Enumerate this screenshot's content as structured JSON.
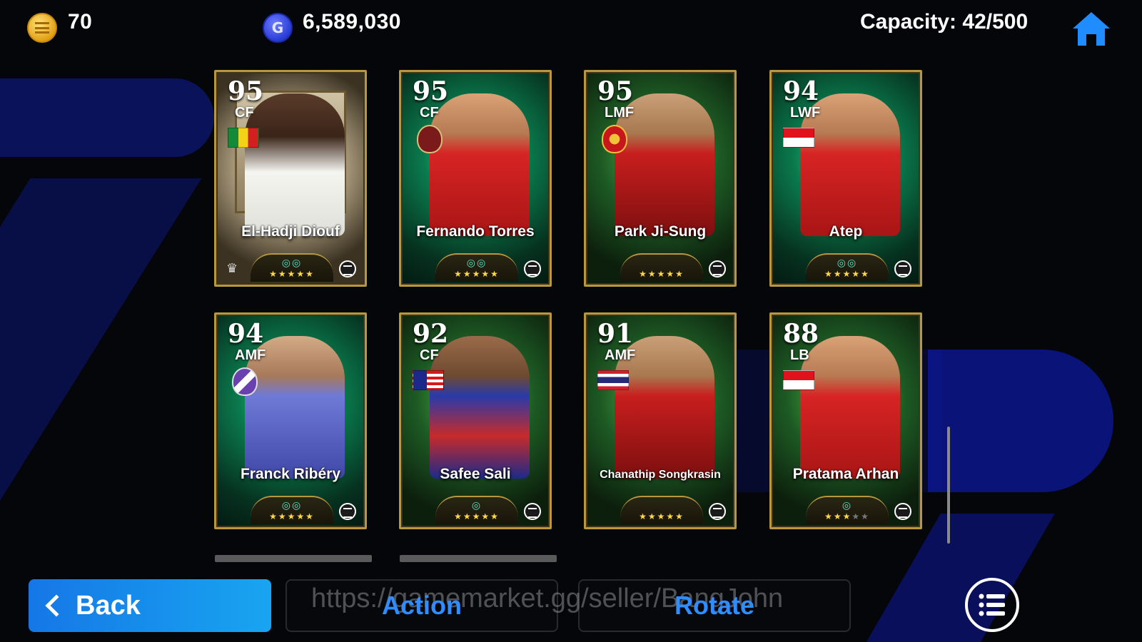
{
  "currency": {
    "ecoin": {
      "icon": "ecoin-icon",
      "value": "70"
    },
    "gp": {
      "icon": "gp-coin-icon",
      "symbol": "G",
      "value": "6,589,030"
    }
  },
  "capacity": "Capacity: 42/500",
  "home_icon": "home-icon",
  "cards": [
    {
      "rating": "95",
      "position": "CF",
      "name": "El-Hadji Diouf",
      "emblem": "flag-senegal",
      "skills": 2,
      "stars": 5
    },
    {
      "rating": "95",
      "position": "CF",
      "name": "Fernando Torres",
      "emblem": "club-badge",
      "skills": 2,
      "stars": 5
    },
    {
      "rating": "95",
      "position": "LMF",
      "name": "Park Ji-Sung",
      "emblem": "club-badge",
      "skills": 0,
      "stars": 5
    },
    {
      "rating": "94",
      "position": "LWF",
      "name": "Atep",
      "emblem": "flag-indonesia",
      "skills": 2,
      "stars": 5
    },
    {
      "rating": "94",
      "position": "AMF",
      "name": "Franck Ribéry",
      "emblem": "club-badge",
      "skills": 2,
      "stars": 5
    },
    {
      "rating": "92",
      "position": "CF",
      "name": "Safee Sali",
      "emblem": "flag-malaysia",
      "skills": 1,
      "stars": 5
    },
    {
      "rating": "91",
      "position": "AMF",
      "name": "Chanathip Songkrasin",
      "emblem": "flag-thailand",
      "skills": 0,
      "stars": 5
    },
    {
      "rating": "88",
      "position": "LB",
      "name": "Pratama Arhan",
      "emblem": "flag-indonesia",
      "skills": 1,
      "stars": 3
    }
  ],
  "buttons": {
    "back": "Back",
    "action": "Action",
    "rotate": "Rotate",
    "menu_icon": "list-menu-icon"
  },
  "watermark": "https://gamemarket.gg/seller/BangJohn",
  "colors": {
    "accent_blue": "#2f8dff",
    "back_button": "#1577e6",
    "card_border": "#b9973f"
  }
}
